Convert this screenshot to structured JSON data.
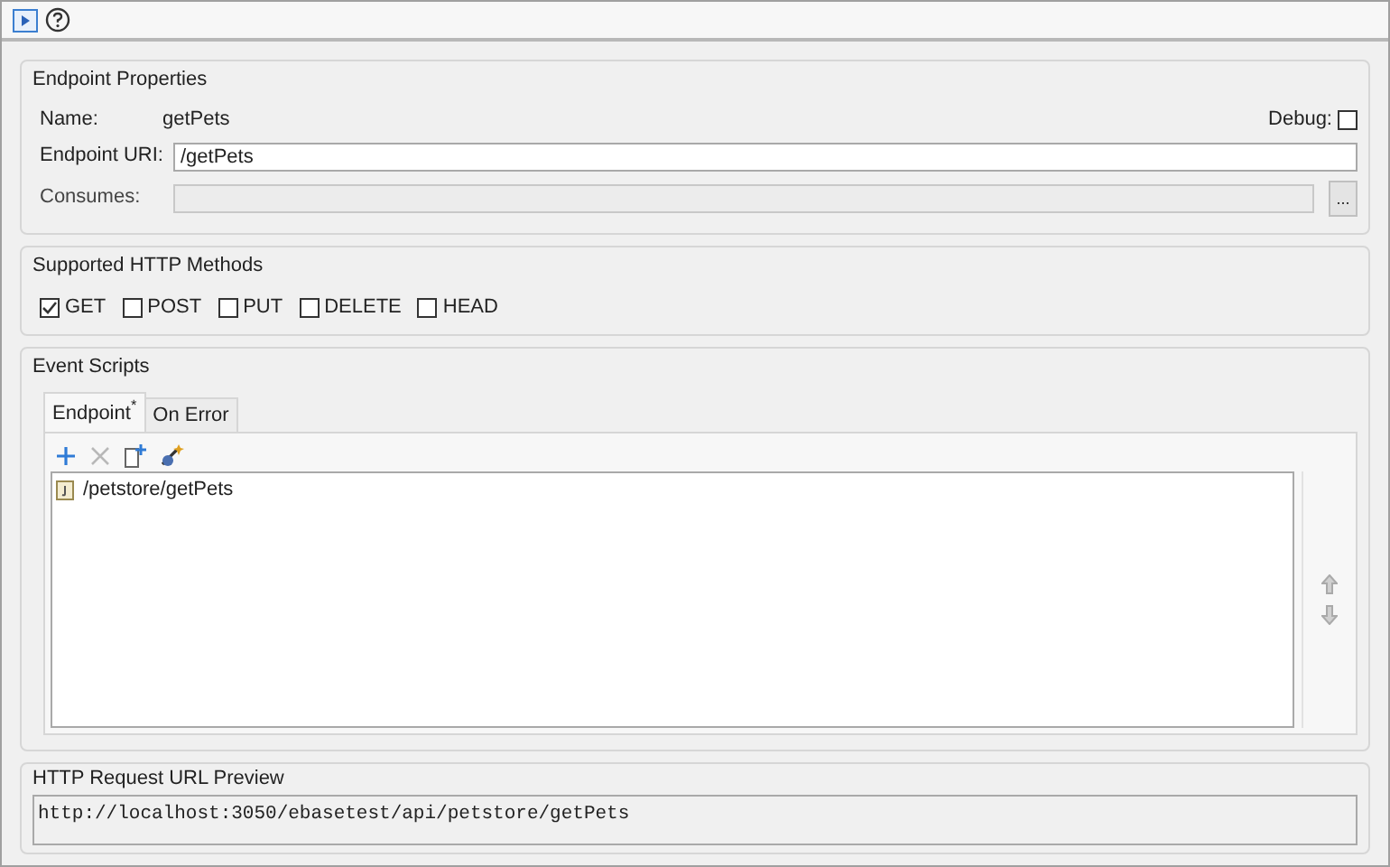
{
  "endpoint_properties": {
    "title": "Endpoint Properties",
    "name_label": "Name:",
    "name_value": "getPets",
    "debug_label": "Debug:",
    "debug_checked": false,
    "uri_label": "Endpoint URI:",
    "uri_value": "/getPets",
    "consumes_label": "Consumes:",
    "browse_button": "..."
  },
  "http_methods": {
    "title": "Supported HTTP Methods",
    "methods": [
      {
        "label": "GET",
        "checked": true
      },
      {
        "label": "POST",
        "checked": false
      },
      {
        "label": "PUT",
        "checked": false
      },
      {
        "label": "DELETE",
        "checked": false
      },
      {
        "label": "HEAD",
        "checked": false
      }
    ]
  },
  "event_scripts": {
    "title": "Event Scripts",
    "tabs": [
      {
        "label": "Endpoint$^{*}$",
        "selected": true
      },
      {
        "label": "On Error",
        "selected": false
      }
    ],
    "scripts": [
      {
        "label": "/petstore/getPets"
      }
    ]
  },
  "url_preview": {
    "title": "HTTP Request URL Preview",
    "value": "http://localhost:3050/ebasetest/api/petstore/getPets"
  }
}
